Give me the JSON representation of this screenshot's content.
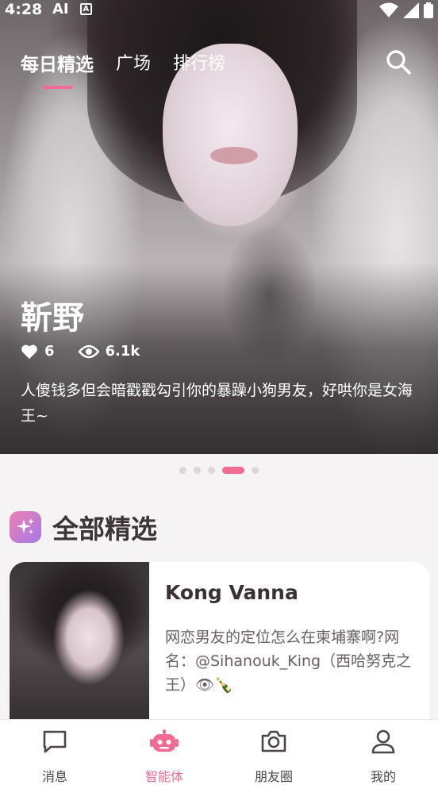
{
  "status_bar": {
    "time": "4:28",
    "ai_label": "AI",
    "a_badge": "A"
  },
  "tabs": [
    {
      "label": "每日精选",
      "active": true
    },
    {
      "label": "广场",
      "active": false
    },
    {
      "label": "排行榜",
      "active": false
    }
  ],
  "hero": {
    "title": "靳野",
    "likes": "6",
    "views": "6.1k",
    "description": "人傻钱多但会暗戳戳勾引你的暴躁小狗男友，好哄你是女海王~"
  },
  "carousel": {
    "count": 5,
    "active_index": 3
  },
  "section": {
    "title": "全部精选",
    "icon": "sparkles-icon"
  },
  "card": {
    "name": "Kong Vanna",
    "description": "网恋男友的定位怎么在柬埔寨啊?网名：@Sihanouk_King（西哈努克之王）👁🍾"
  },
  "bottom_nav": [
    {
      "label": "消息",
      "icon": "message-icon",
      "active": false
    },
    {
      "label": "智能体",
      "icon": "robot-icon",
      "active": true
    },
    {
      "label": "朋友圈",
      "icon": "camera-icon",
      "active": false
    },
    {
      "label": "我的",
      "icon": "user-icon",
      "active": false
    }
  ],
  "colors": {
    "accent": "#f06c92",
    "nav_inactive": "#4d4549",
    "background": "#f6f3f5"
  }
}
